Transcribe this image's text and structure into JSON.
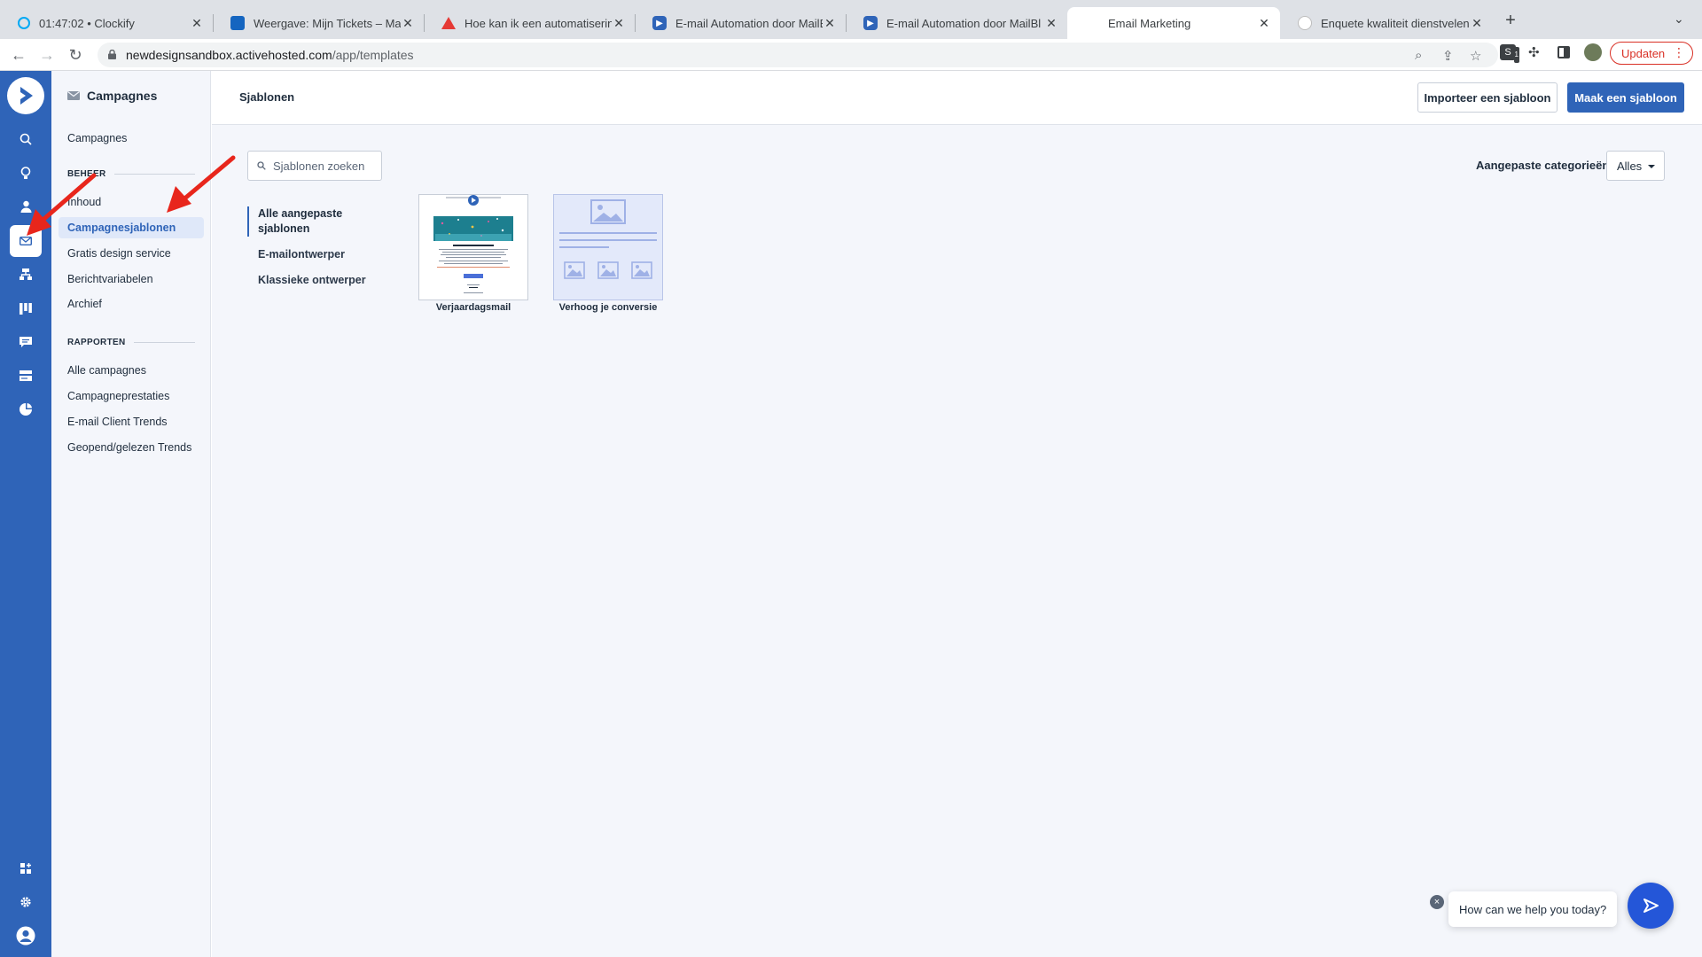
{
  "browser": {
    "tabs": [
      {
        "title": "01:47:02 • Clockify",
        "favicon_color": "#03a9f4",
        "active": false
      },
      {
        "title": "Weergave: Mijn Tickets – MailBl",
        "favicon_color": "#1565c0",
        "active": false
      },
      {
        "title": "Hoe kan ik een automatisering",
        "favicon_color": "#e53935",
        "active": false
      },
      {
        "title": "E-mail Automation door MailBl",
        "favicon_color": "#2f64b8",
        "active": false
      },
      {
        "title": "E-mail Automation door MailBl",
        "favicon_color": "#2f64b8",
        "active": false
      },
      {
        "title": "Email Marketing",
        "favicon_color": "#ffffff",
        "active": true
      },
      {
        "title": "Enquete kwaliteit dienstvelenin",
        "favicon_color": "#bdbdbd",
        "active": false
      }
    ],
    "new_tab": "+",
    "url_host": "newdesignsandbox.activehosted.com",
    "url_path": "/app/templates",
    "update_label": "Updaten",
    "extension_badge": "1"
  },
  "app": {
    "sidebar": {
      "title": "Campagnes",
      "top_item": "Campagnes",
      "section_manage": "BEHEER",
      "manage_items": [
        {
          "label": "Inhoud",
          "active": false
        },
        {
          "label": "Campagnesjablonen",
          "active": true
        },
        {
          "label": "Gratis design service",
          "active": false
        },
        {
          "label": "Berichtvariabelen",
          "active": false
        },
        {
          "label": "Archief",
          "active": false
        }
      ],
      "section_reports": "RAPPORTEN",
      "report_items": [
        {
          "label": "Alle campagnes"
        },
        {
          "label": "Campagneprestaties"
        },
        {
          "label": "E-mail Client Trends"
        },
        {
          "label": "Geopend/gelezen Trends"
        }
      ]
    },
    "header": {
      "title": "Sjablonen",
      "import_button": "Importeer een sjabloon",
      "create_button": "Maak een sjabloon"
    },
    "search": {
      "placeholder": "Sjablonen zoeken",
      "value": ""
    },
    "categories_nav": [
      {
        "label": "Alle aangepaste sjablonen",
        "active": true
      },
      {
        "label": "E-mailontwerper",
        "active": false
      },
      {
        "label": "Klassieke ontwerper",
        "active": false
      }
    ],
    "templates": [
      {
        "name": "Verjaardagsmail"
      },
      {
        "name": "Verhoog je conversie"
      }
    ],
    "filter": {
      "label": "Aangepaste categorieën",
      "selected": "Alles"
    },
    "chat": {
      "prompt": "How can we help you today?",
      "close": "×"
    }
  },
  "colors": {
    "brand": "#2f64b8",
    "rail": "#2f64b8",
    "annotation_arrow": "#e8261c",
    "chat_fab": "#2456d8"
  }
}
